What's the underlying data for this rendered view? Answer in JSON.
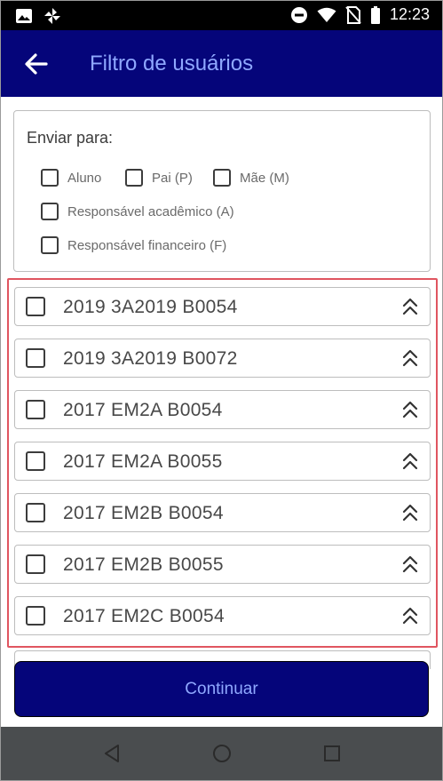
{
  "status_bar": {
    "time": "12:23",
    "left_icons": [
      "image-icon",
      "pinwheel-icon"
    ],
    "right_icons": [
      "do-not-disturb-icon",
      "wifi-icon",
      "no-sim-icon",
      "battery-icon"
    ]
  },
  "header": {
    "back_icon": "arrow-left-icon",
    "title": "Filtro de usuários"
  },
  "send_to": {
    "title": "Enviar para:",
    "options": [
      {
        "label": "Aluno",
        "checked": false
      },
      {
        "label": "Pai (P)",
        "checked": false
      },
      {
        "label": "Mãe (M)",
        "checked": false
      },
      {
        "label": "Responsável acadêmico (A)",
        "checked": false
      },
      {
        "label": "Responsável financeiro (F)",
        "checked": false
      }
    ]
  },
  "classes": [
    {
      "label": "2019 3A2019 B0054",
      "checked": false
    },
    {
      "label": "2019 3A2019 B0072",
      "checked": false
    },
    {
      "label": "2017 EM2A B0054",
      "checked": false
    },
    {
      "label": "2017 EM2A B0055",
      "checked": false
    },
    {
      "label": "2017 EM2B B0054",
      "checked": false
    },
    {
      "label": "2017 EM2B B0055",
      "checked": false
    },
    {
      "label": "2017 EM2C B0054",
      "checked": false
    }
  ],
  "continue_label": "Continuar",
  "colors": {
    "primary": "#05057a",
    "accent_text": "#8fa8ff",
    "highlight": "#e05560",
    "nav_bar": "#4a4d4f"
  },
  "nav_bar": {
    "icons": [
      "back-triangle-icon",
      "home-circle-icon",
      "recents-square-icon"
    ]
  }
}
